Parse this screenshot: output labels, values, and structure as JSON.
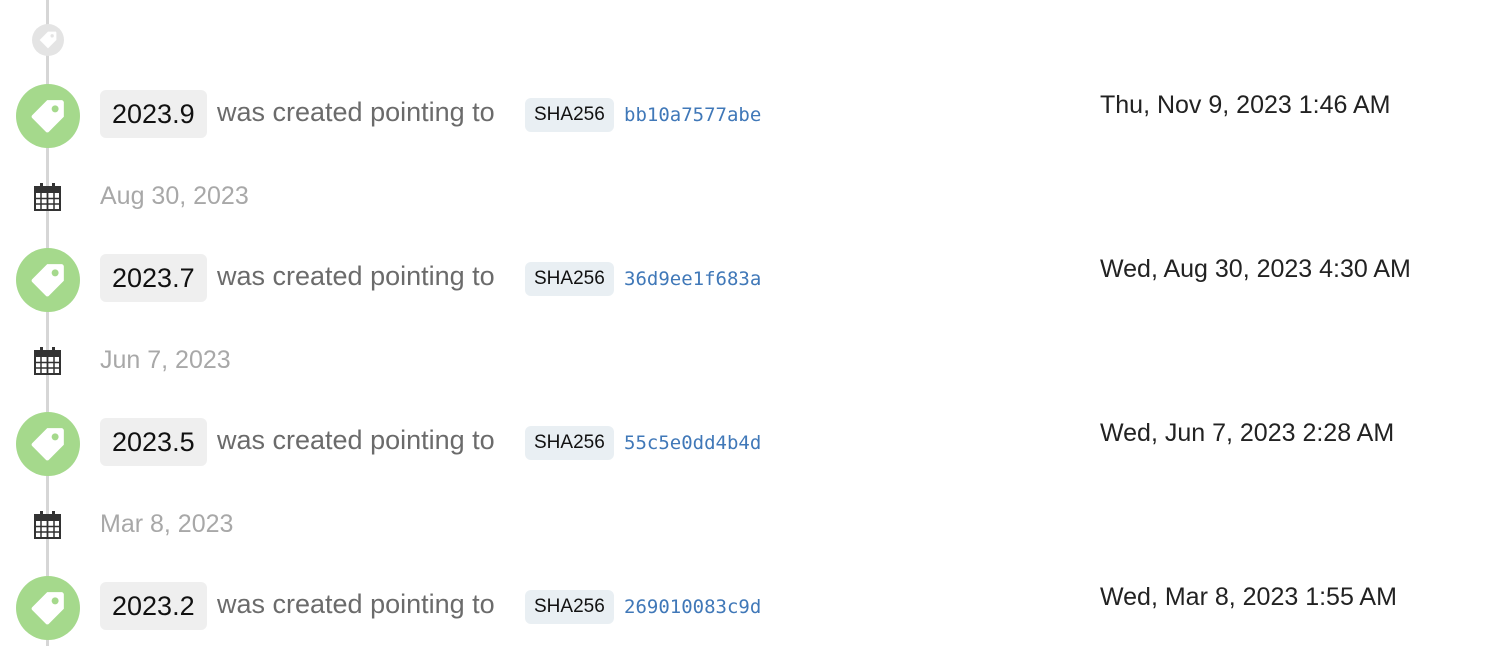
{
  "timeline": {
    "line_color": "#d6d6d6",
    "tag_circle_color": "#a5d98c",
    "hash_link_color": "#4078b8",
    "top_marker_icon": "tag-icon",
    "date_icon": "calendar-icon",
    "events": [
      {
        "version": "2023.9",
        "action_text": "was created pointing to",
        "algorithm": "SHA256",
        "hash": "bb10a7577abe",
        "timestamp": "Thu, Nov 9, 2023 1:46 AM"
      },
      {
        "date_heading": "Aug 30, 2023",
        "version": "2023.7",
        "action_text": "was created pointing to",
        "algorithm": "SHA256",
        "hash": "36d9ee1f683a",
        "timestamp": "Wed, Aug 30, 2023 4:30 AM"
      },
      {
        "date_heading": "Jun 7, 2023",
        "version": "2023.5",
        "action_text": "was created pointing to",
        "algorithm": "SHA256",
        "hash": "55c5e0dd4b4d",
        "timestamp": "Wed, Jun 7, 2023 2:28 AM"
      },
      {
        "date_heading": "Mar 8, 2023",
        "version": "2023.2",
        "action_text": "was created pointing to",
        "algorithm": "SHA256",
        "hash": "269010083c9d",
        "timestamp": "Wed, Mar 8, 2023 1:55 AM"
      }
    ]
  }
}
